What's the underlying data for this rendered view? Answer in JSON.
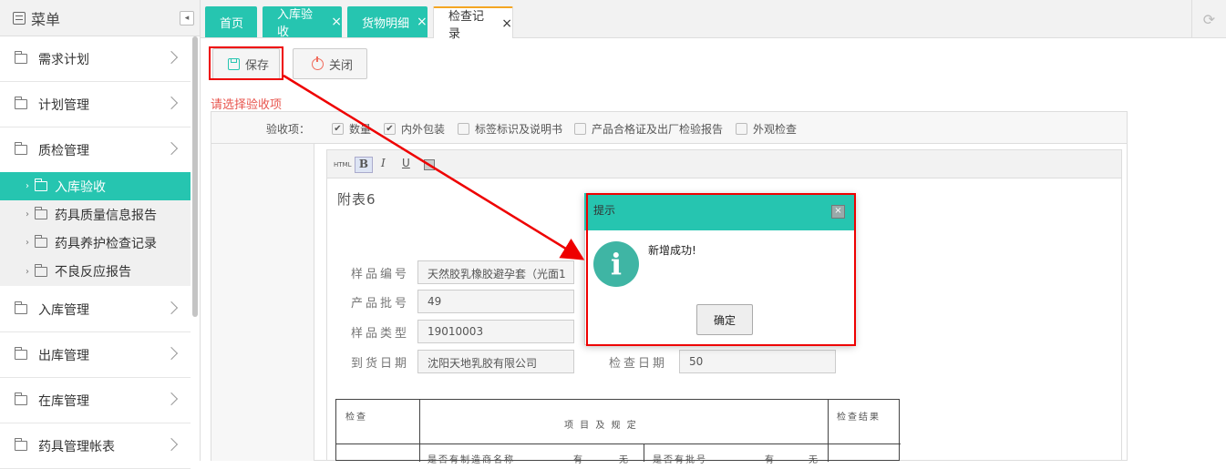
{
  "sidebar": {
    "title": "菜单",
    "collapse_icon": "◂",
    "items": [
      {
        "label": "需求计划"
      },
      {
        "label": "计划管理"
      },
      {
        "label": "质检管理"
      },
      {
        "label": "入库管理"
      },
      {
        "label": "出库管理"
      },
      {
        "label": "在库管理"
      },
      {
        "label": "药具管理帐表"
      }
    ],
    "sub_items": [
      {
        "label": "入库验收",
        "active": true
      },
      {
        "label": "药具质量信息报告"
      },
      {
        "label": "药具养护检查记录"
      },
      {
        "label": "不良反应报告"
      }
    ]
  },
  "tabs": [
    {
      "label": "首页"
    },
    {
      "label": "入库验收",
      "close": "×"
    },
    {
      "label": "货物明细",
      "close": "×"
    },
    {
      "label": "检查记录",
      "close": "×",
      "active": true
    }
  ],
  "toolbar": {
    "save_label": "保存",
    "close_label": "关闭"
  },
  "form": {
    "section_label": "请选择验收项",
    "check_label": "验收项：",
    "checks": [
      {
        "label": "数量",
        "checked": true
      },
      {
        "label": "内外包装",
        "checked": true
      },
      {
        "label": "标签标识及说明书",
        "checked": false
      },
      {
        "label": "产品合格证及出厂检验报告",
        "checked": false
      },
      {
        "label": "外观检查",
        "checked": false
      }
    ]
  },
  "editor": {
    "tools": {
      "html": "HTML",
      "bold": "B",
      "italic": "I",
      "underline": "U"
    },
    "doc_title": "附表6",
    "fields": [
      {
        "label": "样品编号",
        "value": "天然胶乳橡胶避孕套（光面1"
      },
      {
        "label": "产品批号",
        "value": "49"
      },
      {
        "label": "样品类型",
        "value": "19010003"
      },
      {
        "label": "到货日期",
        "value": "沈阳天地乳胶有限公司"
      }
    ],
    "check_date_label": "检查日期",
    "check_date_value": "50",
    "table": {
      "col1": "检查",
      "col2": "项 目 及 规 定",
      "col3": "检查结果",
      "row_a": "是否有制造商名称",
      "row_b": "是否有批号",
      "yes": "有",
      "no": "无"
    }
  },
  "dialog": {
    "title": "提示",
    "close": "×",
    "icon": "i",
    "message": "新增成功!",
    "ok_label": "确定"
  },
  "colors": {
    "accent": "#26c5b0",
    "highlight": "#ee0000",
    "warning": "#e8554e"
  }
}
